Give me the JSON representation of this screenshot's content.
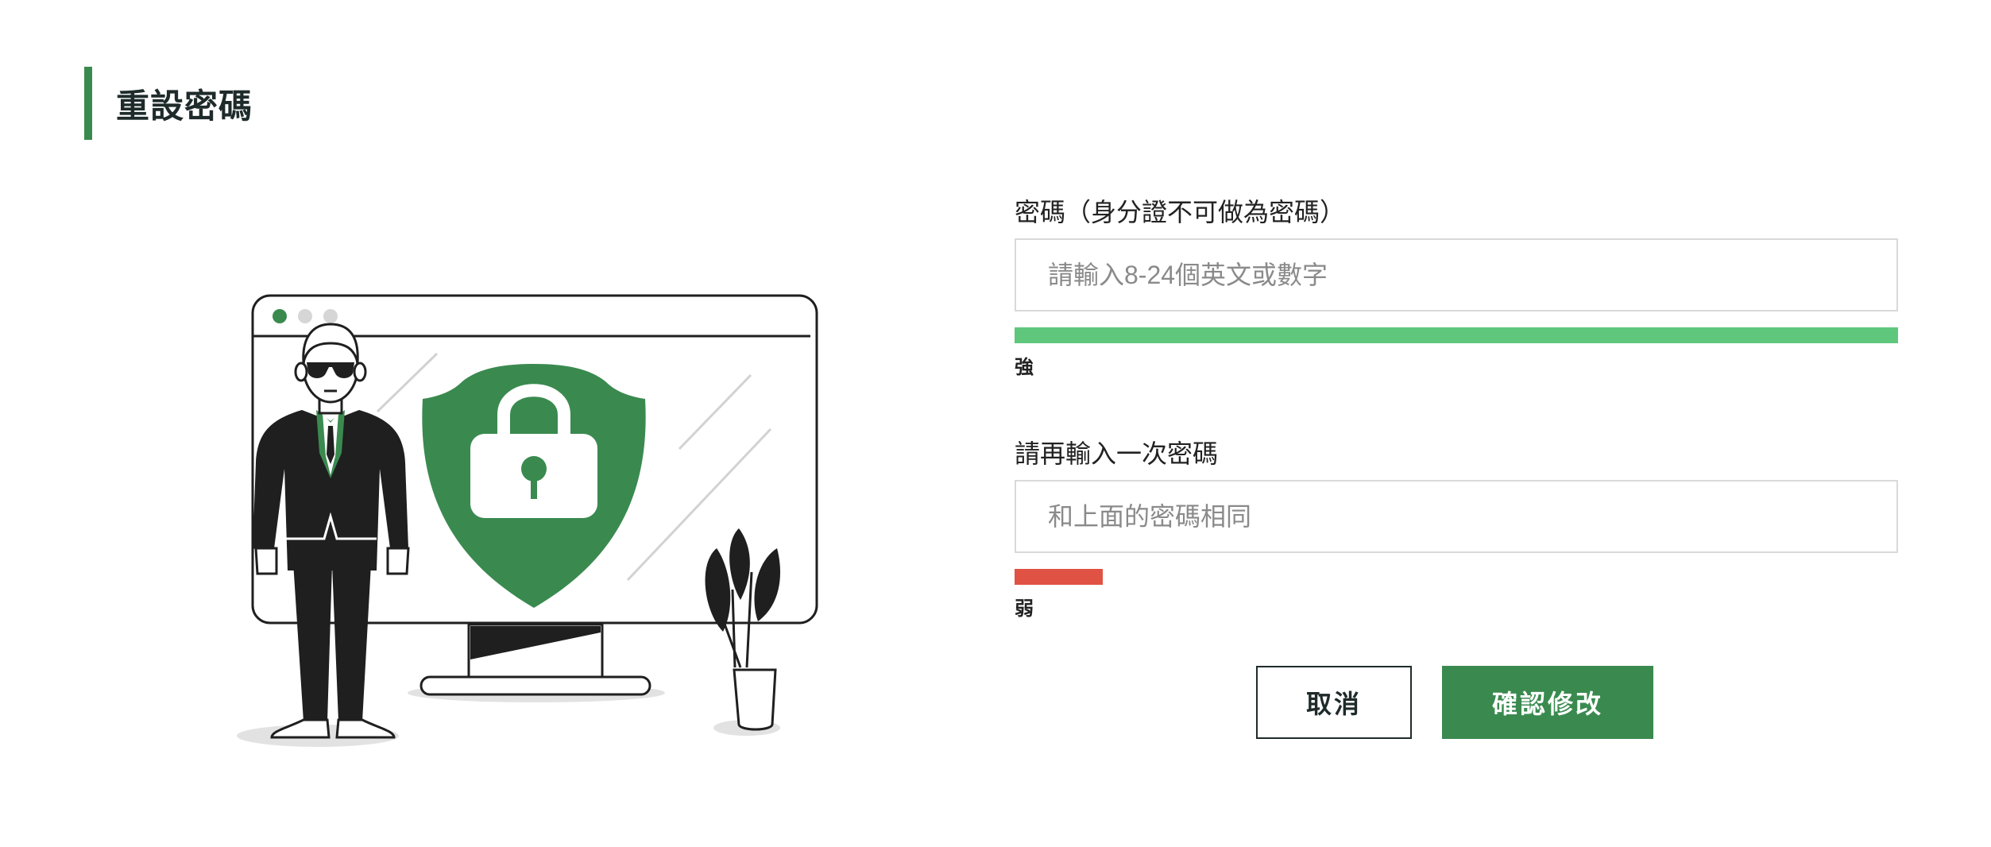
{
  "page": {
    "title": "重設密碼"
  },
  "form": {
    "password": {
      "label": "密碼（身分證不可做為密碼）",
      "placeholder": "請輸入8-24個英文或數字",
      "value": "",
      "strength_label": "強",
      "strength_fraction": 1.0
    },
    "confirm": {
      "label": "請再輸入一次密碼",
      "placeholder": "和上面的密碼相同",
      "value": "",
      "strength_label": "弱",
      "strength_fraction": 0.1
    }
  },
  "buttons": {
    "cancel": "取消",
    "confirm": "確認修改"
  },
  "colors": {
    "accent": "#3a8a4f",
    "strong": "#5fc77c",
    "weak": "#e05243",
    "title_text": "#1f2b2b"
  },
  "illustration": {
    "icons": [
      "browser-window-icon",
      "shield-lock-icon",
      "security-guard-icon",
      "potted-plant-icon"
    ]
  }
}
